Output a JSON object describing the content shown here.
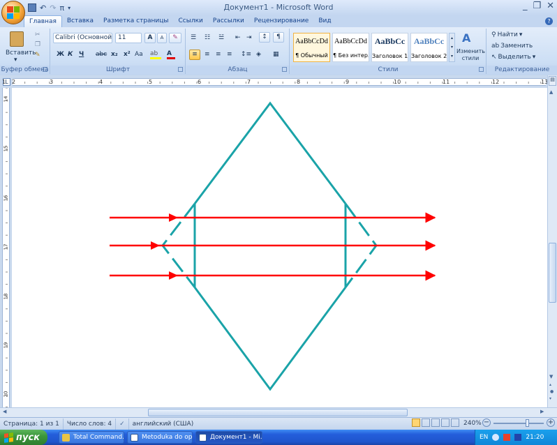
{
  "window": {
    "title": "Документ1 - Microsoft Word",
    "controls": {
      "minimize": "_",
      "restore": "❐",
      "close": "✕"
    }
  },
  "qat": {
    "undo": "↶",
    "redo": "↷",
    "symbol": "π"
  },
  "tabs": [
    {
      "label": "Главная",
      "active": true
    },
    {
      "label": "Вставка"
    },
    {
      "label": "Разметка страницы"
    },
    {
      "label": "Ссылки"
    },
    {
      "label": "Рассылки"
    },
    {
      "label": "Рецензирование"
    },
    {
      "label": "Вид"
    }
  ],
  "ribbon": {
    "clipboard": {
      "label": "Буфер обмена",
      "paste": "Вставить"
    },
    "font": {
      "label": "Шрифт",
      "font_name": "Calibri (Основной тек",
      "font_size": "11",
      "grow": "A",
      "shrink": "A",
      "bold": "Ж",
      "italic": "К",
      "underline": "Ч",
      "strike": "abc",
      "subscript": "x₂",
      "superscript": "x²",
      "case": "Aa"
    },
    "paragraph": {
      "label": "Абзац",
      "pilcrow": "¶"
    },
    "styles": {
      "label": "Стили",
      "items": [
        {
          "sample": "AaBbCcDd",
          "name": "¶ Обычный"
        },
        {
          "sample": "AaBbCcDd",
          "name": "¶ Без интер..."
        },
        {
          "sample": "AaBbCc",
          "name": "Заголовок 1"
        },
        {
          "sample": "AaBbCc",
          "name": "Заголовок 2"
        }
      ],
      "change_styles": "Изменить стили"
    },
    "editing": {
      "label": "Редактирование",
      "find": "Найти",
      "replace": "Заменить",
      "select": "Выделить"
    }
  },
  "hruler": {
    "numbers": [
      "1",
      "2",
      "3",
      "4",
      "5",
      "6",
      "7",
      "8",
      "9",
      "10",
      "11",
      "12",
      "13"
    ]
  },
  "vruler": {
    "numbers": [
      "14",
      "15",
      "16",
      "17",
      "18",
      "19",
      "20"
    ]
  },
  "status": {
    "page": "Страница: 1 из 1",
    "words": "Число слов: 4",
    "language": "английский (США)",
    "zoom": "240%"
  },
  "taskbar": {
    "start": "пуск",
    "tasks": [
      {
        "label": "Total Command..."
      },
      {
        "label": "Metoduka do op..."
      },
      {
        "label": "Документ1 - Mi..."
      }
    ],
    "lang": "EN",
    "time": "21:20"
  },
  "colors": {
    "shape": "#1aa3a8",
    "arrow": "#ff0000"
  }
}
